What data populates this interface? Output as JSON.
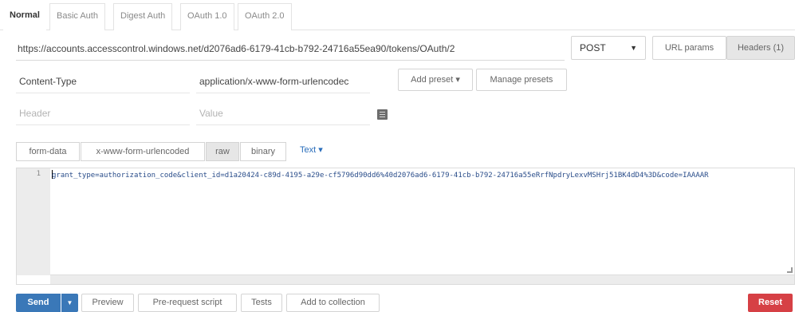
{
  "auth_tabs": [
    {
      "label": "Normal",
      "active": true
    },
    {
      "label": "Basic Auth",
      "active": false
    },
    {
      "label": "Digest Auth",
      "active": false
    },
    {
      "label": "OAuth 1.0",
      "active": false
    },
    {
      "label": "OAuth 2.0",
      "active": false
    }
  ],
  "request": {
    "url": "https://accounts.accesscontrol.windows.net/d2076ad6-6179-41cb-b792-24716a55ea90/tokens/OAuth/2",
    "method": "POST",
    "method_caret": "▼",
    "url_params_label": "URL params",
    "headers_label": "Headers (1)"
  },
  "headers": {
    "rows": [
      {
        "key": "Content-Type",
        "value": "application/x-www-form-urlencodec"
      }
    ],
    "key_placeholder": "Header",
    "value_placeholder": "Value",
    "add_preset_label": "Add preset ▾",
    "manage_presets_label": "Manage presets"
  },
  "body": {
    "tabs": [
      {
        "label": "form-data",
        "active": false
      },
      {
        "label": "x-www-form-urlencoded",
        "active": false
      },
      {
        "label": "raw",
        "active": true
      },
      {
        "label": "binary",
        "active": false
      }
    ],
    "text_type_label": "Text ▾",
    "line_number": "1",
    "code": "grant_type=authorization_code&client_id=d1a20424-c89d-4195-a29e-cf5796d90dd6%40d2076ad6-6179-41cb-b792-24716a55eRrfNpdryLexvMSHrj51BK4dD4%3D&code=IAAAAR"
  },
  "actions": {
    "send_label": "Send",
    "send_caret": "▼",
    "preview_label": "Preview",
    "prerequest_label": "Pre-request script",
    "tests_label": "Tests",
    "add_collection_label": "Add to collection",
    "reset_label": "Reset"
  },
  "colors": {
    "send": "#3a78b8",
    "reset": "#d64045",
    "text_link": "#2a6ebb"
  }
}
